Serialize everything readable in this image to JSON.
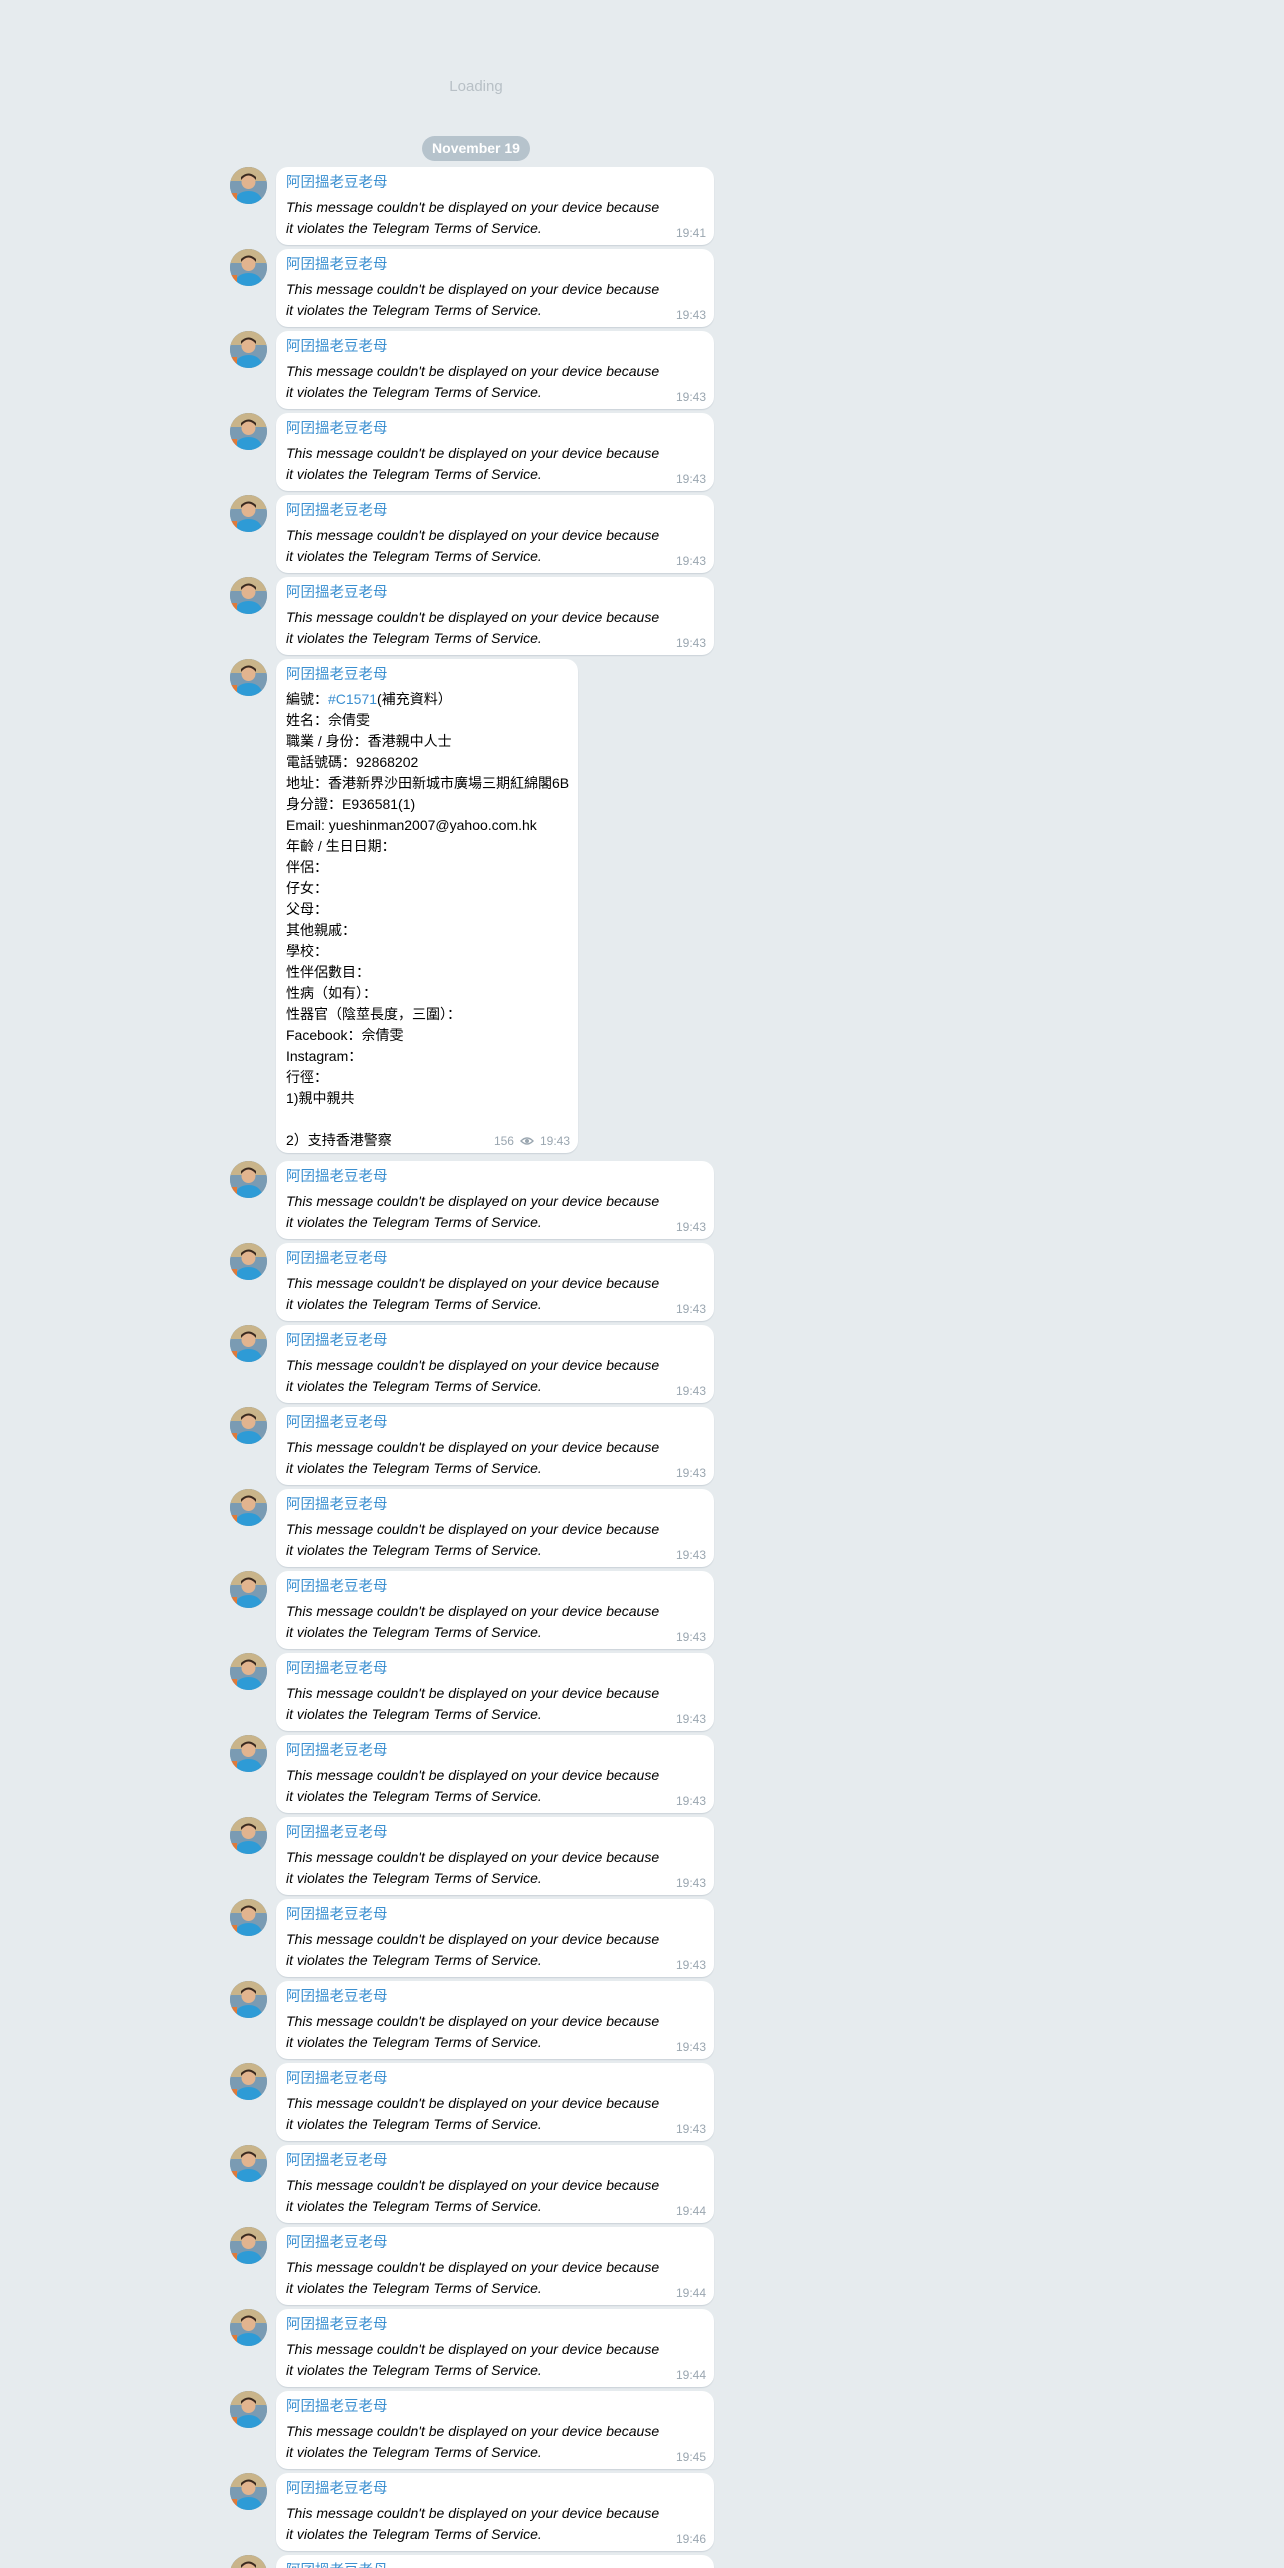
{
  "loading_text": "Loading",
  "date_separator": "November 19",
  "sender_name": "阿囝搵老豆老母",
  "blocked_text": "This message couldn't be displayed on your device because it violates the Telegram Terms of Service.",
  "colors": {
    "background": "#e6ebee",
    "sender": "#3a8fd0",
    "time": "#9aa6b0",
    "date_pill": "#b6c3cc"
  },
  "messages_before": [
    {
      "time": "19:41"
    },
    {
      "time": "19:43"
    },
    {
      "time": "19:43"
    },
    {
      "time": "19:43"
    },
    {
      "time": "19:43"
    },
    {
      "time": "19:43"
    }
  ],
  "profile_message": {
    "hashtag_prefix": "編號：",
    "hashtag": "#C1571",
    "hashtag_suffix": "(補充資料）",
    "lines": [
      "姓名：佘倩雯",
      "職業 / 身份：香港親中人士",
      "電話號碼：92868202",
      "地址：香港新界沙田新城市廣場三期紅綿閣6B",
      "身分證：E936581(1)",
      "Email: yueshinman2007@yahoo.com.hk",
      "年齡 / 生日日期：",
      "伴侶：",
      "仔女：",
      "父母：",
      "其他親戚：",
      "學校：",
      "性伴侶數目：",
      "性病（如有）：",
      "性器官（陰莖長度，三圍）：",
      "Facebook：佘倩雯",
      "Instagram：",
      "行徑：",
      "1)親中親共",
      "",
      "2）支持香港警察"
    ],
    "views": "156",
    "time": "19:43"
  },
  "messages_after": [
    {
      "time": "19:43"
    },
    {
      "time": "19:43"
    },
    {
      "time": "19:43"
    },
    {
      "time": "19:43"
    },
    {
      "time": "19:43"
    },
    {
      "time": "19:43"
    },
    {
      "time": "19:43"
    },
    {
      "time": "19:43"
    },
    {
      "time": "19:43"
    },
    {
      "time": "19:43"
    },
    {
      "time": "19:43"
    },
    {
      "time": "19:43"
    },
    {
      "time": "19:44"
    },
    {
      "time": "19:44"
    },
    {
      "time": "19:44"
    },
    {
      "time": "19:45"
    },
    {
      "time": "19:46"
    },
    {
      "time": ""
    }
  ]
}
